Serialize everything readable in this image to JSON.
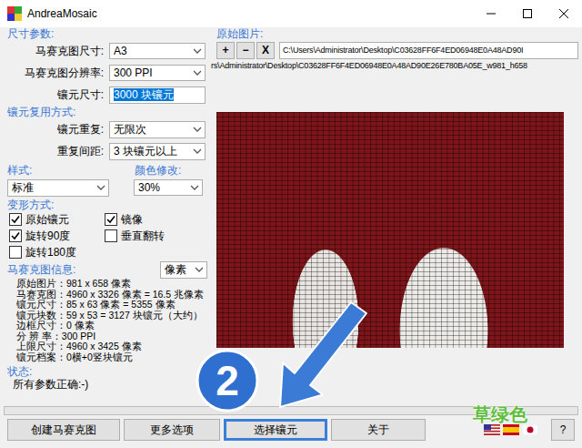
{
  "window": {
    "title": "AndreaMosaic"
  },
  "size_section": {
    "heading": "尺寸参数:",
    "fields": [
      {
        "label": "马赛克图尺寸:",
        "value": "A3",
        "kind": "select",
        "text_selected": false
      },
      {
        "label": "马赛克图分辨率:",
        "value": "300 PPI",
        "kind": "select",
        "text_selected": false
      },
      {
        "label": "镶元尺寸:",
        "value": "3000 块镶元",
        "kind": "input",
        "text_selected": true
      }
    ]
  },
  "reuse_section": {
    "heading": "镶元复用方式:",
    "fields": [
      {
        "label": "镶元重复:",
        "value": "无限次",
        "kind": "select",
        "text_selected": false
      },
      {
        "label": "重复间距:",
        "value": "3 块镶元以上",
        "kind": "select",
        "text_selected": false
      }
    ]
  },
  "style": {
    "label": "样式:",
    "value": "标准"
  },
  "color_mod": {
    "label": "颜色修改:",
    "value": "30%"
  },
  "transform_section": {
    "heading": "变形方式:",
    "options": [
      {
        "label": "原始镶元",
        "checked": true
      },
      {
        "label": "镜像",
        "checked": true
      },
      {
        "label": "旋转90度",
        "checked": true
      },
      {
        "label": "垂直翻转",
        "checked": false
      },
      {
        "label": "旋转180度",
        "checked": false
      }
    ]
  },
  "info_section": {
    "heading": "马赛克图信息:",
    "unit": "像素",
    "lines": [
      "原始图片：981 x 658 像素",
      "马赛克图：4960 x 3326 像素 = 16.5 兆像素",
      "镶元尺寸：85 x 63 像素 = 5355 像素",
      "镶元块数：59 x 53 = 3127 块镶元（大约）",
      "边框尺寸：0 像素",
      "分 辨 率：300 PPI",
      "上限尺寸：4960 x 3425 像素",
      "镶元档案：0横+0竖块镶元"
    ]
  },
  "status": {
    "heading": "状态:",
    "message": "所有参数正确:-)",
    "level": 0
  },
  "source": {
    "heading": "原始图片:",
    "buttons": [
      "+",
      "−",
      "X"
    ],
    "path": "C:\\Users\\Administrator\\Desktop\\C03628FF6F4ED06948E0A48AD90I",
    "full_path": "rs\\Administrator\\Desktop\\C03628FF6F4ED06948E0A48AD90E26E780BA05E_w981_h658"
  },
  "bottom_buttons": [
    {
      "label": "创建马赛克图",
      "highlighted": false
    },
    {
      "label": "更多选项",
      "highlighted": false
    },
    {
      "label": "选择镶元",
      "highlighted": true
    },
    {
      "label": "关于",
      "highlighted": false
    }
  ],
  "help_button": "?",
  "annotation": {
    "number": "2"
  },
  "watermark": "草绿色"
}
